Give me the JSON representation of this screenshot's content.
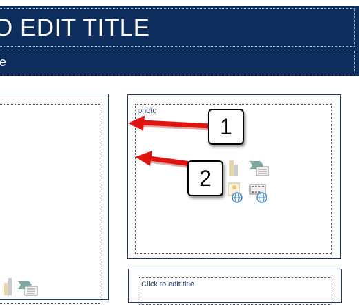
{
  "slide": {
    "title": "O EDIT TITLE",
    "subtitle": "tle"
  },
  "panels": {
    "left": {
      "placeholder_label": ""
    },
    "right_top": {
      "placeholder_label": "photo"
    },
    "right_bottom": {
      "placeholder_label": "Click to edit title"
    }
  },
  "callouts": [
    {
      "number": "1"
    },
    {
      "number": "2"
    }
  ],
  "icons": [
    "chart-icon",
    "smartart-icon",
    "picture-icon",
    "video-icon"
  ],
  "colors": {
    "title_band": "#0d2d5c",
    "panel_border": "#1f3864",
    "arrow_red": "#e0140f"
  }
}
